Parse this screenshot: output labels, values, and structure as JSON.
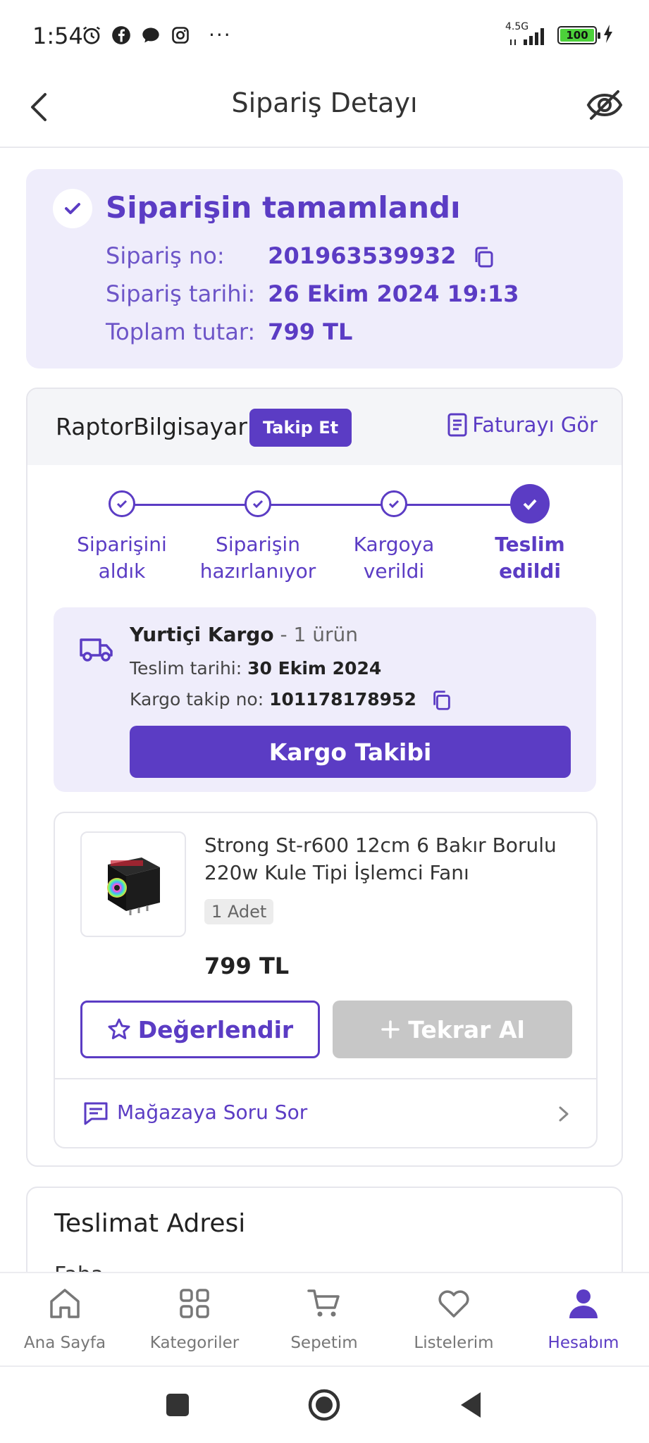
{
  "status_bar": {
    "time": "1:54",
    "network": "4.5G",
    "battery": "100"
  },
  "header": {
    "title": "Sipariş Detayı"
  },
  "order_summary": {
    "status_title": "Siparişin tamamlandı",
    "order_no_label": "Sipariş no:",
    "order_no": "201963539932",
    "order_date_label": "Sipariş tarihi:",
    "order_date": "26 Ekim 2024 19:13",
    "total_label": "Toplam tutar:",
    "total": "799 TL"
  },
  "seller": {
    "name": "RaptorBilgisayar",
    "follow_label": "Takip Et",
    "invoice_label": "Faturayı Gör"
  },
  "steps": [
    {
      "line1": "Siparişini",
      "line2": "aldık"
    },
    {
      "line1": "Siparişin",
      "line2": "hazırlanıyor"
    },
    {
      "line1": "Kargoya",
      "line2": "verildi"
    },
    {
      "line1": "Teslim",
      "line2": "edildi"
    }
  ],
  "shipment": {
    "carrier": "Yurtiçi Kargo",
    "item_count": "- 1 ürün",
    "delivery_label": "Teslim tarihi:",
    "delivery_date": "30 Ekim 2024",
    "tracking_label": "Kargo takip no:",
    "tracking_no": "101178178952",
    "track_button": "Kargo Takibi"
  },
  "product": {
    "title": "Strong St-r600 12cm 6 Bakır Borulu 220w Kule Tipi İşlemci Fanı",
    "quantity": "1 Adet",
    "price": "799 TL",
    "rate_button": "Değerlendir",
    "buy_again_button": "Tekrar Al",
    "ask_store": "Mağazaya Soru Sor"
  },
  "address": {
    "title": "Teslimat Adresi",
    "peek": "Faha..."
  },
  "bottom_nav": [
    {
      "label": "Ana Sayfa"
    },
    {
      "label": "Kategoriler"
    },
    {
      "label": "Sepetim"
    },
    {
      "label": "Listelerim"
    },
    {
      "label": "Hesabım"
    }
  ],
  "colors": {
    "brand": "#5b3cc4",
    "tint": "#efedfb",
    "disabled": "#c7c7c7"
  }
}
